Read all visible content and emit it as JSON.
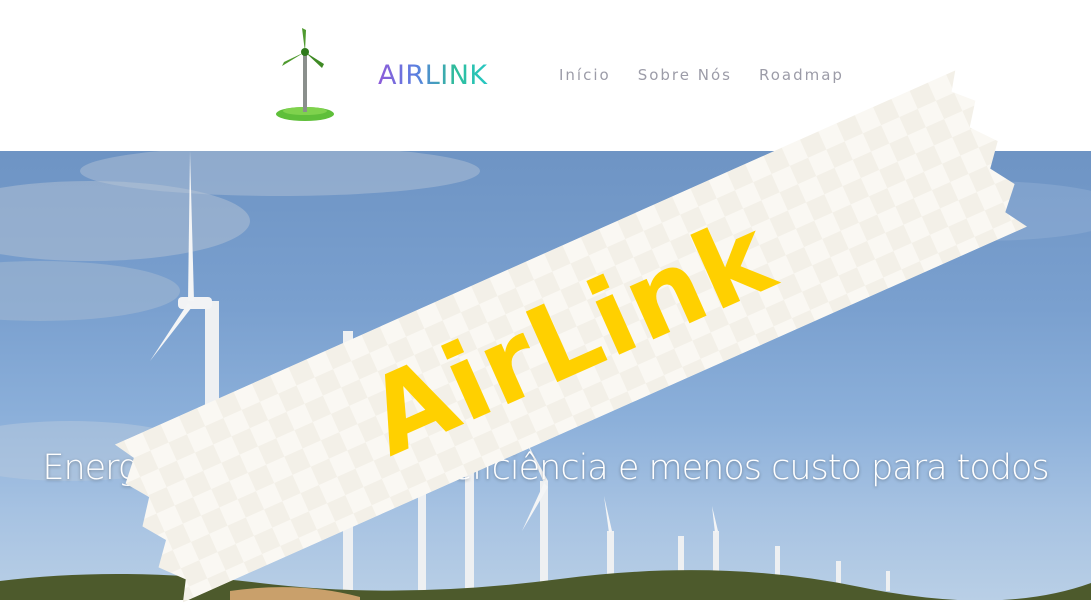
{
  "header": {
    "brand": "AIRLINK",
    "nav": [
      "Início",
      "Sobre Nós",
      "Roadmap"
    ]
  },
  "hero": {
    "tagline": "Energia limpa com mais eficiência e menos custo para todos"
  },
  "overlay": {
    "tape_label": "AirLink"
  },
  "colors": {
    "brand_gradient": [
      "#8e5bd9",
      "#27c7c4"
    ],
    "nav_text": "#9c9ca8",
    "tape_text": "#ffd000",
    "tape_bg": "#faf8f3"
  },
  "icons": [
    "wind-turbine-logo-icon"
  ]
}
